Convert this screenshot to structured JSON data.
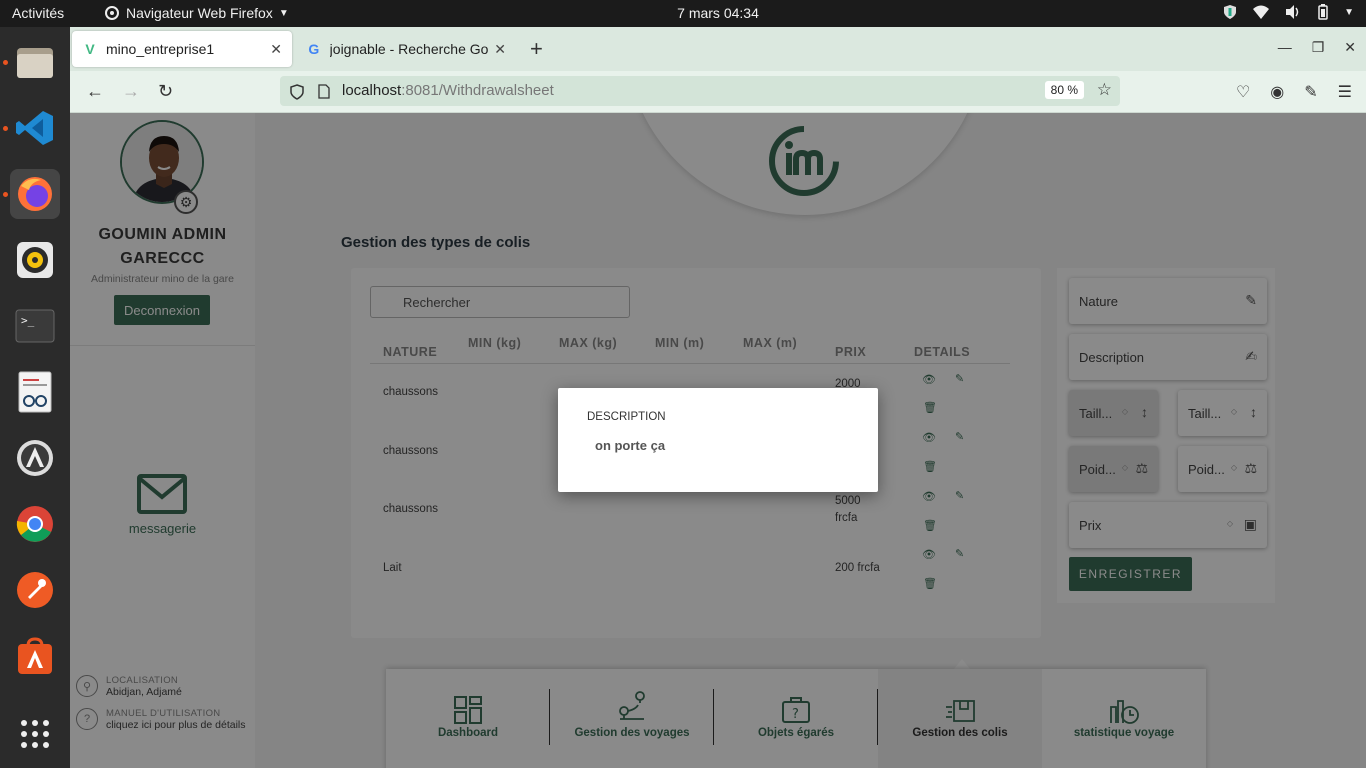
{
  "topbar": {
    "activities": "Activités",
    "app_name": "Navigateur Web Firefox",
    "clock": "7 mars  04:34"
  },
  "dock": {
    "items": [
      "files-icon",
      "vscode-icon",
      "firefox-icon",
      "rhythmbox-icon",
      "terminal-icon",
      "document-viewer-icon",
      "software-updater-icon",
      "chrome-icon",
      "postman-icon",
      "app-store-icon",
      "show-apps-icon"
    ]
  },
  "browser": {
    "tabs": [
      {
        "label": "mino_entreprise1"
      },
      {
        "label": "joignable - Recherche Go"
      }
    ],
    "url_host": "localhost",
    "url_path": ":8081/Withdrawalsheet",
    "zoom": "80 %"
  },
  "sidebar": {
    "user_name": "GOUMIN ADMIN GARECCC",
    "user_role": "Administrateur mino de la gare",
    "logout_label": "Deconnexion",
    "messaging_label": "messagerie",
    "location_title": "LOCALISATION",
    "location_value": "Abidjan, Adjamé",
    "manual_title": "MANUEL D'UTILISATION",
    "manual_value": "cliquez ici pour plus de détails"
  },
  "main": {
    "section_title": "Gestion des types de colis",
    "search_placeholder": "Rechercher",
    "columns": [
      "NATURE",
      "MIN (kg)",
      "MAX (kg)",
      "MIN (m)",
      "MAX (m)",
      "PRIX",
      "DETAILS"
    ],
    "rows": [
      {
        "nature": "chaussons",
        "prix": "2000"
      },
      {
        "nature": "chaussons",
        "prix": ""
      },
      {
        "nature": "chaussons",
        "prix": "5000 frcfa"
      },
      {
        "nature": "Lait",
        "prix": "200 frcfa"
      }
    ]
  },
  "form": {
    "nature_label": "Nature",
    "description_label": "Description",
    "taille_min_label": "Taill...",
    "taille_max_label": "Taill...",
    "poids_min_label": "Poid...",
    "poids_max_label": "Poid...",
    "prix_label": "Prix",
    "save_label": "ENREGISTRER"
  },
  "bottom_nav": [
    {
      "label": "Dashboard"
    },
    {
      "label": "Gestion des voyages"
    },
    {
      "label": "Objets égarés"
    },
    {
      "label": "Gestion des colis"
    },
    {
      "label": "statistique voyage"
    }
  ],
  "modal": {
    "title": "DESCRIPTION",
    "value": "on porte ça"
  },
  "colors": {
    "accent": "#3c6e57",
    "topbar": "#1b1b1b",
    "dock": "#2b2b2b"
  }
}
